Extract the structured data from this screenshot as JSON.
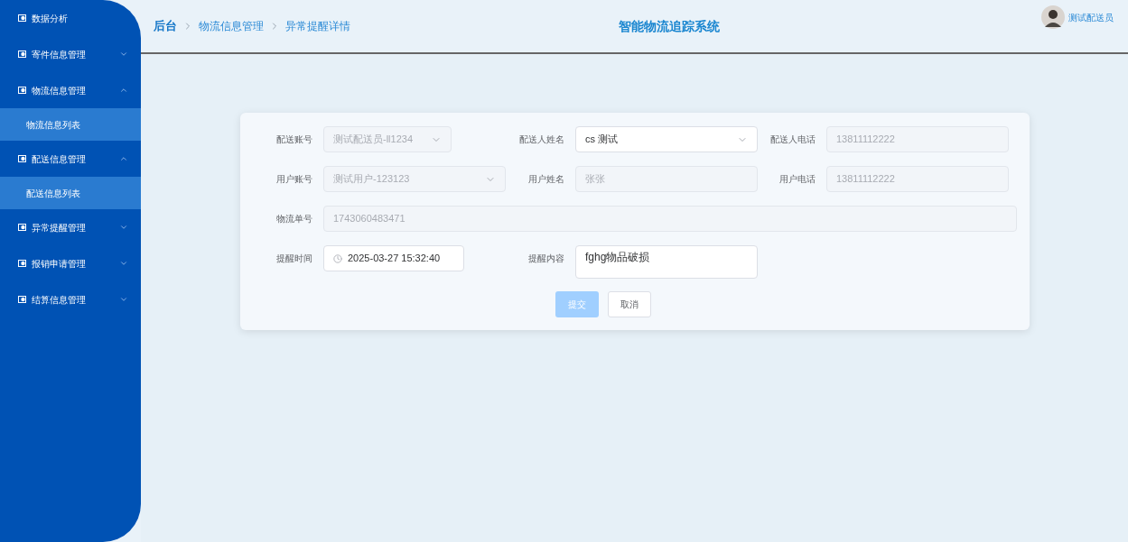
{
  "sidebar": {
    "items": [
      {
        "label": "数据分析",
        "kind": "link"
      },
      {
        "label": "寄件信息管理",
        "kind": "group",
        "expanded": false
      },
      {
        "label": "物流信息管理",
        "kind": "group",
        "expanded": true,
        "children": [
          {
            "label": "物流信息列表"
          }
        ]
      },
      {
        "label": "配送信息管理",
        "kind": "group",
        "expanded": true,
        "children": [
          {
            "label": "配送信息列表"
          }
        ]
      },
      {
        "label": "异常提醒管理",
        "kind": "group",
        "expanded": false
      },
      {
        "label": "报销申请管理",
        "kind": "group",
        "expanded": false
      },
      {
        "label": "结算信息管理",
        "kind": "group",
        "expanded": false
      }
    ]
  },
  "header": {
    "breadcrumb": [
      "后台",
      "物流信息管理",
      "异常提醒详情"
    ],
    "title": "智能物流追踪系统",
    "user": "测试配送员"
  },
  "form": {
    "rows": [
      [
        {
          "label": "配送账号",
          "kind": "select",
          "value": "测试配送员-ll1234",
          "disabled": true
        },
        {
          "label": "配送人姓名",
          "kind": "select",
          "value": "cs 测试",
          "disabled": false
        },
        {
          "label": "配送人电话",
          "kind": "input",
          "value": "13811112222",
          "disabled": true
        }
      ],
      [
        {
          "label": "用户账号",
          "kind": "select",
          "value": "测试用户-123123",
          "disabled": true
        },
        {
          "label": "用户姓名",
          "kind": "input",
          "value": "张张",
          "disabled": true
        },
        {
          "label": "用户电话",
          "kind": "input",
          "value": "13811112222",
          "disabled": true
        }
      ],
      [
        {
          "label": "物流单号",
          "kind": "input",
          "value": "1743060483471",
          "disabled": true
        }
      ],
      [
        {
          "label": "提醒时间",
          "kind": "date",
          "value": "2025-03-27 15:32:40",
          "disabled": false
        },
        {
          "label": "提醒内容",
          "kind": "textarea",
          "value": "fghg物品破损",
          "disabled": false
        }
      ]
    ],
    "buttons": [
      {
        "label": "提交",
        "kind": "primary"
      },
      {
        "label": "取消",
        "kind": "default"
      }
    ]
  }
}
